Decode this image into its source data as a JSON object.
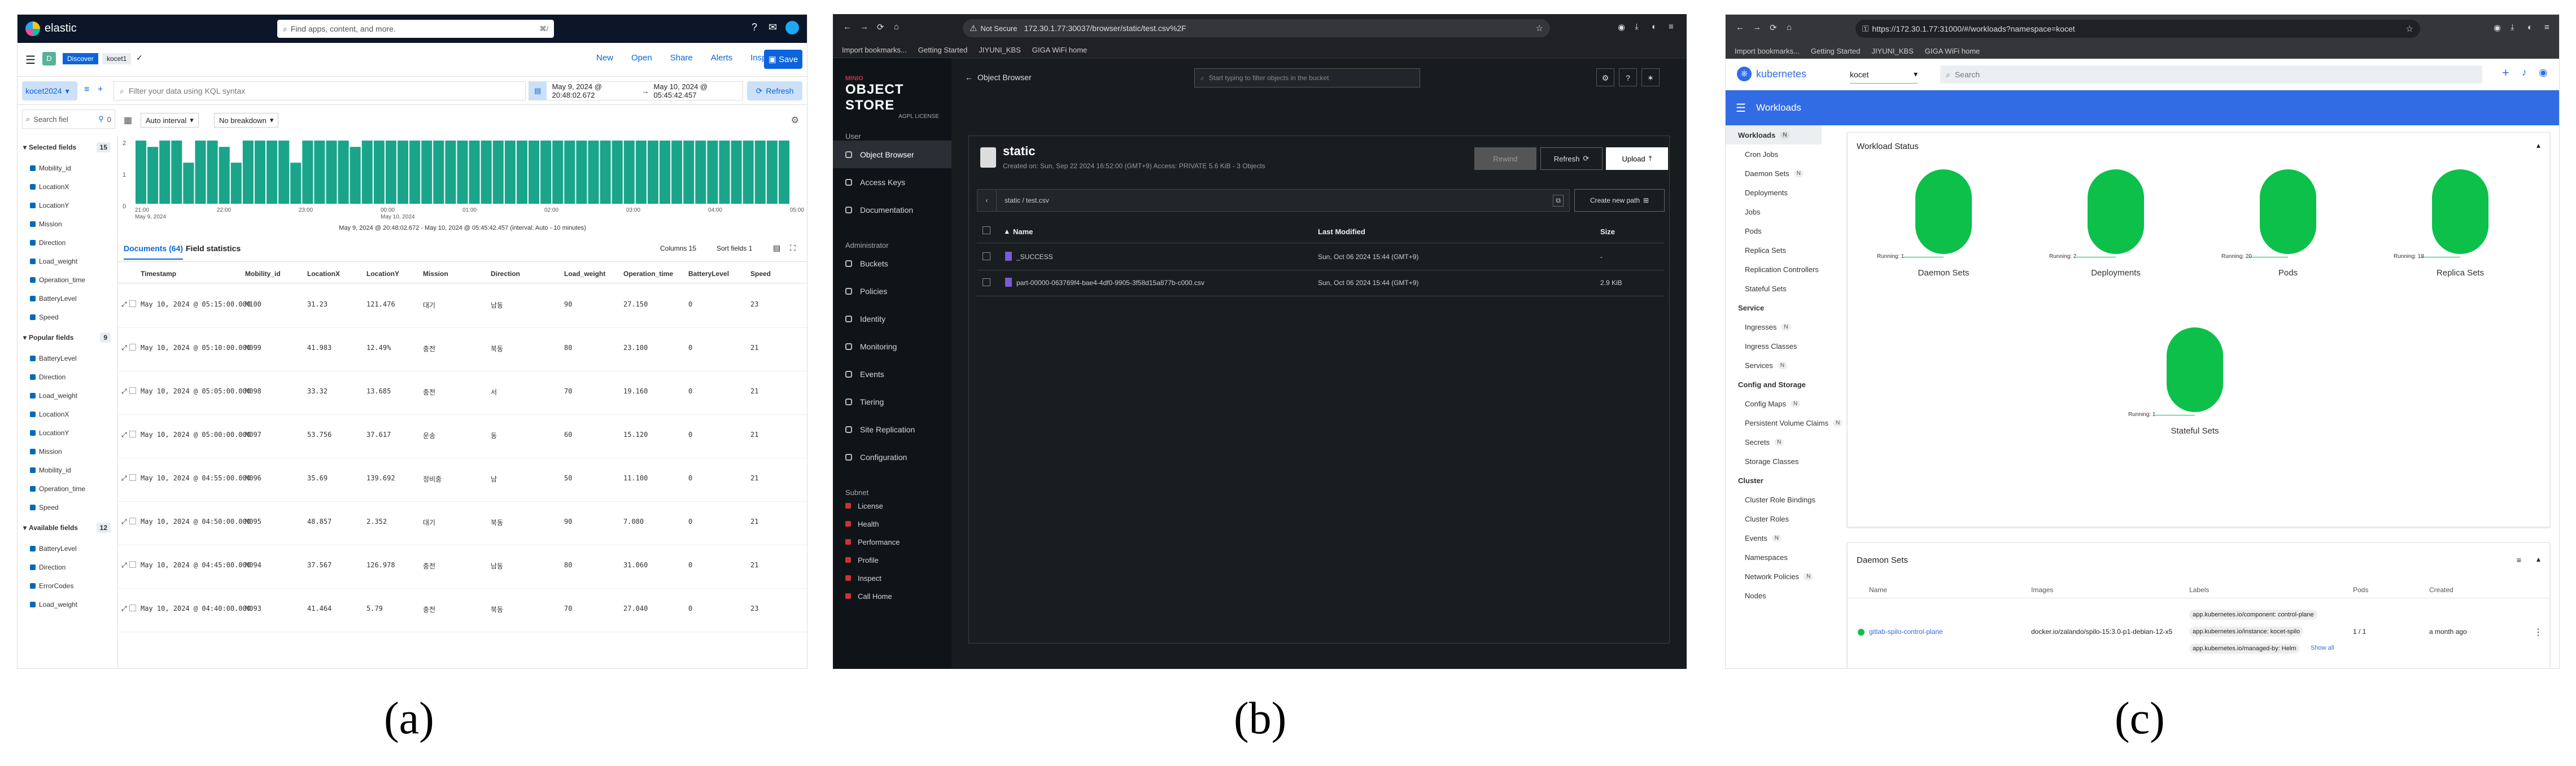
{
  "captions": {
    "a": "(a)",
    "b": "(b)",
    "c": "(c)"
  },
  "elastic": {
    "logo": "elastic",
    "search_placeholder": "Find apps, content, and more.",
    "search_shortcut": "⌘/",
    "app_badge": "D",
    "crumbs": [
      "Discover",
      "kocet1"
    ],
    "actions": [
      "New",
      "Open",
      "Share",
      "Alerts",
      "Inspect"
    ],
    "save": "Save",
    "dataview": "kocet2024",
    "kql_placeholder": "Filter your data using KQL syntax",
    "date_from": "May 9, 2024 @ 20:48:02.672",
    "date_arrow": "→",
    "date_to": "May 10, 2024 @ 05:45:42.457",
    "refresh": "Refresh",
    "field_search": "Search fiel",
    "filter_count": "0",
    "interval": "Auto interval",
    "breakdown": "No breakdown",
    "chart_footer": "May 9, 2024 @ 20:48:02.672 - May 10, 2024 @ 05:45:42.457 (interval: Auto - 10 minutes)",
    "tabs": [
      "Documents (64)",
      "Field statistics"
    ],
    "table_controls": [
      "Columns 15",
      "Sort fields 1"
    ],
    "selected_title": "Selected fields",
    "selected_count": "15",
    "selected_fields": [
      "Mobility_id",
      "LocationX",
      "LocationY",
      "Mission",
      "Direction",
      "Load_weight",
      "Operation_time",
      "BatteryLevel",
      "Speed"
    ],
    "popular_title": "Popular fields",
    "popular_count": "9",
    "popular_fields": [
      "BatteryLevel",
      "Direction",
      "Load_weight",
      "LocationX",
      "LocationY",
      "Mission",
      "Mobility_id",
      "Operation_time",
      "Speed"
    ],
    "available_title": "Available fields",
    "available_count": "12",
    "available_fields": [
      "BatteryLevel",
      "Direction",
      "ErrorCodes",
      "Load_weight"
    ],
    "columns": [
      "Timestamp",
      "Mobility_id",
      "LocationX",
      "LocationY",
      "Mission",
      "Direction",
      "Load_weight",
      "Operation_time",
      "BatteryLevel",
      "Speed"
    ],
    "rows": [
      [
        "May 10, 2024 @ 05:15:00.000",
        "M100",
        "31.23",
        "121.476",
        "대기",
        "남동",
        "90",
        "27.150",
        "0",
        "23"
      ],
      [
        "May 10, 2024 @ 05:10:00.000",
        "M099",
        "41.983",
        "12.49%",
        "충전",
        "북동",
        "80",
        "23.100",
        "0",
        "21"
      ],
      [
        "May 10, 2024 @ 05:05:00.000",
        "M098",
        "33.32",
        "13.685",
        "충전",
        "서",
        "70",
        "19.160",
        "0",
        "21"
      ],
      [
        "May 10, 2024 @ 05:00:00.000",
        "M097",
        "53.756",
        "37.617",
        "운송",
        "동",
        "60",
        "15.120",
        "0",
        "21"
      ],
      [
        "May 10, 2024 @ 04:55:00.000",
        "M096",
        "35.69",
        "139.692",
        "정비중",
        "남",
        "50",
        "11.100",
        "0",
        "21"
      ],
      [
        "May 10, 2024 @ 04:50:00.000",
        "M095",
        "48.857",
        "2.352",
        "대기",
        "북동",
        "90",
        "7.080",
        "0",
        "21"
      ],
      [
        "May 10, 2024 @ 04:45:00.000",
        "M094",
        "37.567",
        "126.978",
        "충전",
        "남동",
        "80",
        "31.060",
        "0",
        "21"
      ],
      [
        "May 10, 2024 @ 04:40:00.000",
        "M093",
        "41.464",
        "5.79",
        "충전",
        "북동",
        "70",
        "27.040",
        "0",
        "23"
      ]
    ],
    "histogram": {
      "ticks": [
        "21:00\nMay 9, 2024",
        "22:00",
        "23:00",
        "00:00\nMay 10, 2024",
        "01:00",
        "02:00",
        "03:00",
        "04:00",
        "05:00"
      ],
      "heights": [
        1,
        0.9,
        1,
        1,
        0.65,
        1,
        1,
        0.9,
        0.65,
        1,
        1,
        1,
        1,
        0.65,
        1,
        1,
        1,
        1,
        0.9,
        1,
        1,
        1,
        1,
        1,
        1,
        1,
        1,
        1,
        1,
        1,
        1,
        1,
        1,
        1,
        1,
        1,
        1,
        1,
        1,
        1,
        1,
        1,
        1,
        1,
        1,
        1,
        1,
        1,
        1,
        1,
        1,
        1,
        1,
        1,
        1
      ],
      "ylabels": [
        "2",
        "1",
        "0"
      ],
      "bar_color": "#1aa58b"
    }
  },
  "minio": {
    "url_warning": "Not Secure",
    "url": "172.30.1.77:30037/browser/static/test.csv%2F",
    "bookmarks": [
      "Import bookmarks...",
      "Getting Started",
      "JIYUNI_KBS",
      "GIGA WiFi home"
    ],
    "brand_top": "MINIO",
    "brand": "OBJECT STORE",
    "brand_sub": "AGPL LICENSE",
    "object_browser": "Object Browser",
    "filter_placeholder": "Start typing to filter objects in the bucket",
    "nav_user_title": "User",
    "nav_user": [
      "Object Browser",
      "Access Keys",
      "Documentation"
    ],
    "nav_admin_title": "Administrator",
    "nav_admin": [
      "Buckets",
      "Policies",
      "Identity",
      "Monitoring",
      "Events",
      "Tiering",
      "Site Replication",
      "Configuration"
    ],
    "nav_sub_title": "Subnet",
    "nav_sub": [
      "License",
      "Health",
      "Performance",
      "Profile",
      "Inspect",
      "Call Home"
    ],
    "bucket": "static",
    "bucket_meta": "Created on: Sun, Sep 22 2024 16:52:00 (GMT+9)   Access: PRIVATE   5.6 KiB - 3 Objects",
    "rewind": "Rewind",
    "refresh": "Refresh",
    "upload": "Upload",
    "path": "static / test.csv",
    "create_path": "Create new path",
    "cols": [
      "Name",
      "Last Modified",
      "Size"
    ],
    "files": [
      {
        "name": "_SUCCESS",
        "modified": "Sun, Oct 06 2024 15:44 (GMT+9)",
        "size": "-"
      },
      {
        "name": "part-00000-063769f4-bae4-4df0-9905-3f58d15a877b-c000.csv",
        "modified": "Sun, Oct 06 2024 15:44 (GMT+9)",
        "size": "2.9 KiB"
      }
    ]
  },
  "k8s": {
    "url": "https://172.30.1.77:31000/#/workloads?namespace=kocet",
    "bookmarks": [
      "Import bookmarks...",
      "Getting Started",
      "JIYUNI_KBS",
      "GIGA WiFi home"
    ],
    "brand": "kubernetes",
    "namespace": "kocet",
    "search_placeholder": "Search",
    "section": "Workloads",
    "nav": [
      {
        "g": "Workloads",
        "badge": "N",
        "items": [
          [
            "Cron Jobs",
            ""
          ],
          [
            "Daemon Sets",
            "N"
          ],
          [
            "Deployments",
            ""
          ],
          [
            "Jobs",
            ""
          ],
          [
            "Pods",
            ""
          ],
          [
            "Replica Sets",
            ""
          ],
          [
            "Replication Controllers",
            ""
          ],
          [
            "Stateful Sets",
            ""
          ]
        ]
      },
      {
        "g": "Service",
        "items": [
          [
            "Ingresses",
            "N"
          ],
          [
            "Ingress Classes",
            ""
          ],
          [
            "Services",
            "N"
          ]
        ]
      },
      {
        "g": "Config and Storage",
        "items": [
          [
            "Config Maps",
            "N"
          ],
          [
            "Persistent Volume Claims",
            "N"
          ],
          [
            "Secrets",
            "N"
          ],
          [
            "Storage Classes",
            ""
          ]
        ]
      },
      {
        "g": "Cluster",
        "items": [
          [
            "Cluster Role Bindings",
            ""
          ],
          [
            "Cluster Roles",
            ""
          ],
          [
            "Events",
            "N"
          ],
          [
            "Namespaces",
            ""
          ],
          [
            "Network Policies",
            "N"
          ],
          [
            "Nodes",
            ""
          ]
        ]
      }
    ],
    "status_title": "Workload Status",
    "status": [
      {
        "label": "Daemon Sets",
        "running": "Running: 1"
      },
      {
        "label": "Deployments",
        "running": "Running: 2"
      },
      {
        "label": "Pods",
        "running": "Running: 20"
      },
      {
        "label": "Replica Sets",
        "running": "Running: 18"
      },
      {
        "label": "Stateful Sets",
        "running": "Running: 1"
      }
    ],
    "ds_title": "Daemon Sets",
    "ds_cols": [
      "Name",
      "Images",
      "Labels",
      "Pods",
      "Created"
    ],
    "ds_row": {
      "name": "gitlab-spilo-control-plane",
      "image": "docker.io/zalando/spilo-15:3.0-p1-debian-12-x5",
      "labels": [
        "app.kubernetes.io/component: control-plane",
        "app.kubernetes.io/instance: kocet-spilo",
        "app.kubernetes.io/managed-by: Helm"
      ],
      "show_all": "Show all",
      "pods": "1 / 1",
      "created": "a month ago"
    }
  }
}
